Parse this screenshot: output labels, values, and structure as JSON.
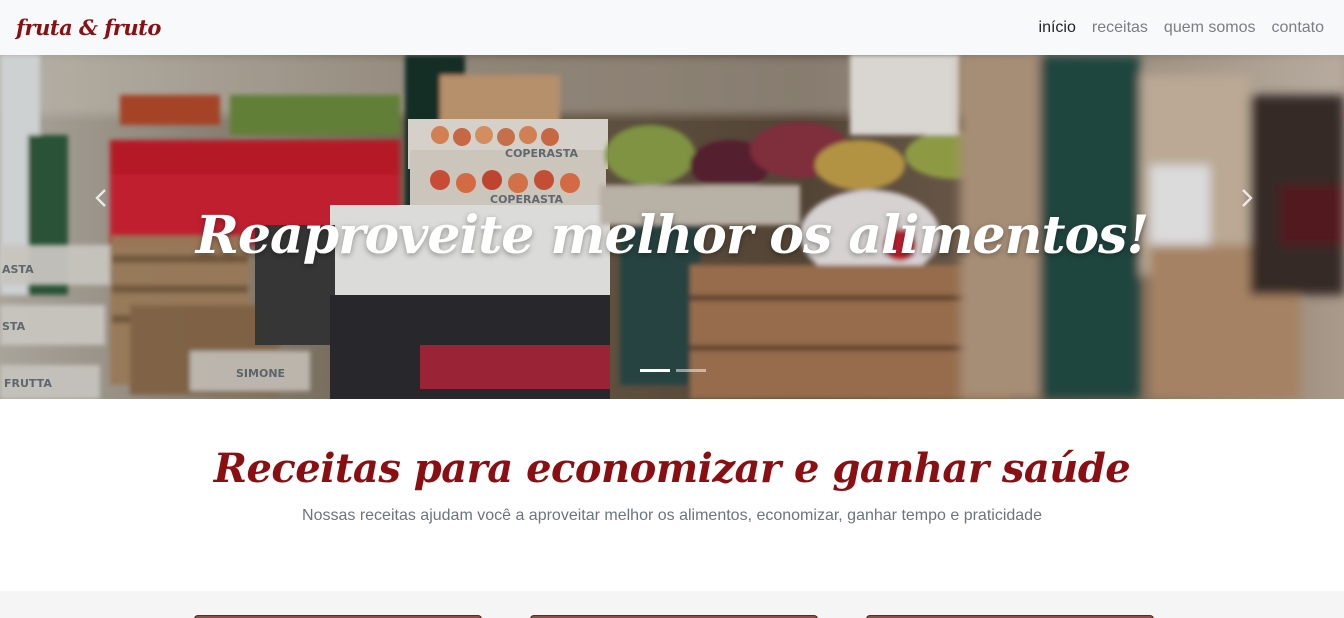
{
  "navbar": {
    "brand": "fruta & fruto",
    "links": [
      "início",
      "receitas",
      "quem somos",
      "contato"
    ],
    "active_index": 0
  },
  "carousel": {
    "caption": "Reaproveite melhor os alimentos!",
    "prev_icon": "chevron-left-icon",
    "next_icon": "chevron-right-icon",
    "slide_count": 2,
    "active_slide": 0,
    "crate_labels": [
      "COPERASTA",
      "COPERASTA",
      "ASTA",
      "STA",
      "FRUTTA",
      "SIMONE"
    ]
  },
  "recipes_section": {
    "title": "Receitas para economizar e ganhar saúde",
    "subtitle": "Nossas receitas ajudam você a aproveitar melhor os alimentos, economizar, ganhar tempo e praticidade"
  },
  "colors": {
    "brand": "#8b0f12",
    "navbar_bg": "#f8f9fa",
    "muted_text": "#6c757d"
  }
}
